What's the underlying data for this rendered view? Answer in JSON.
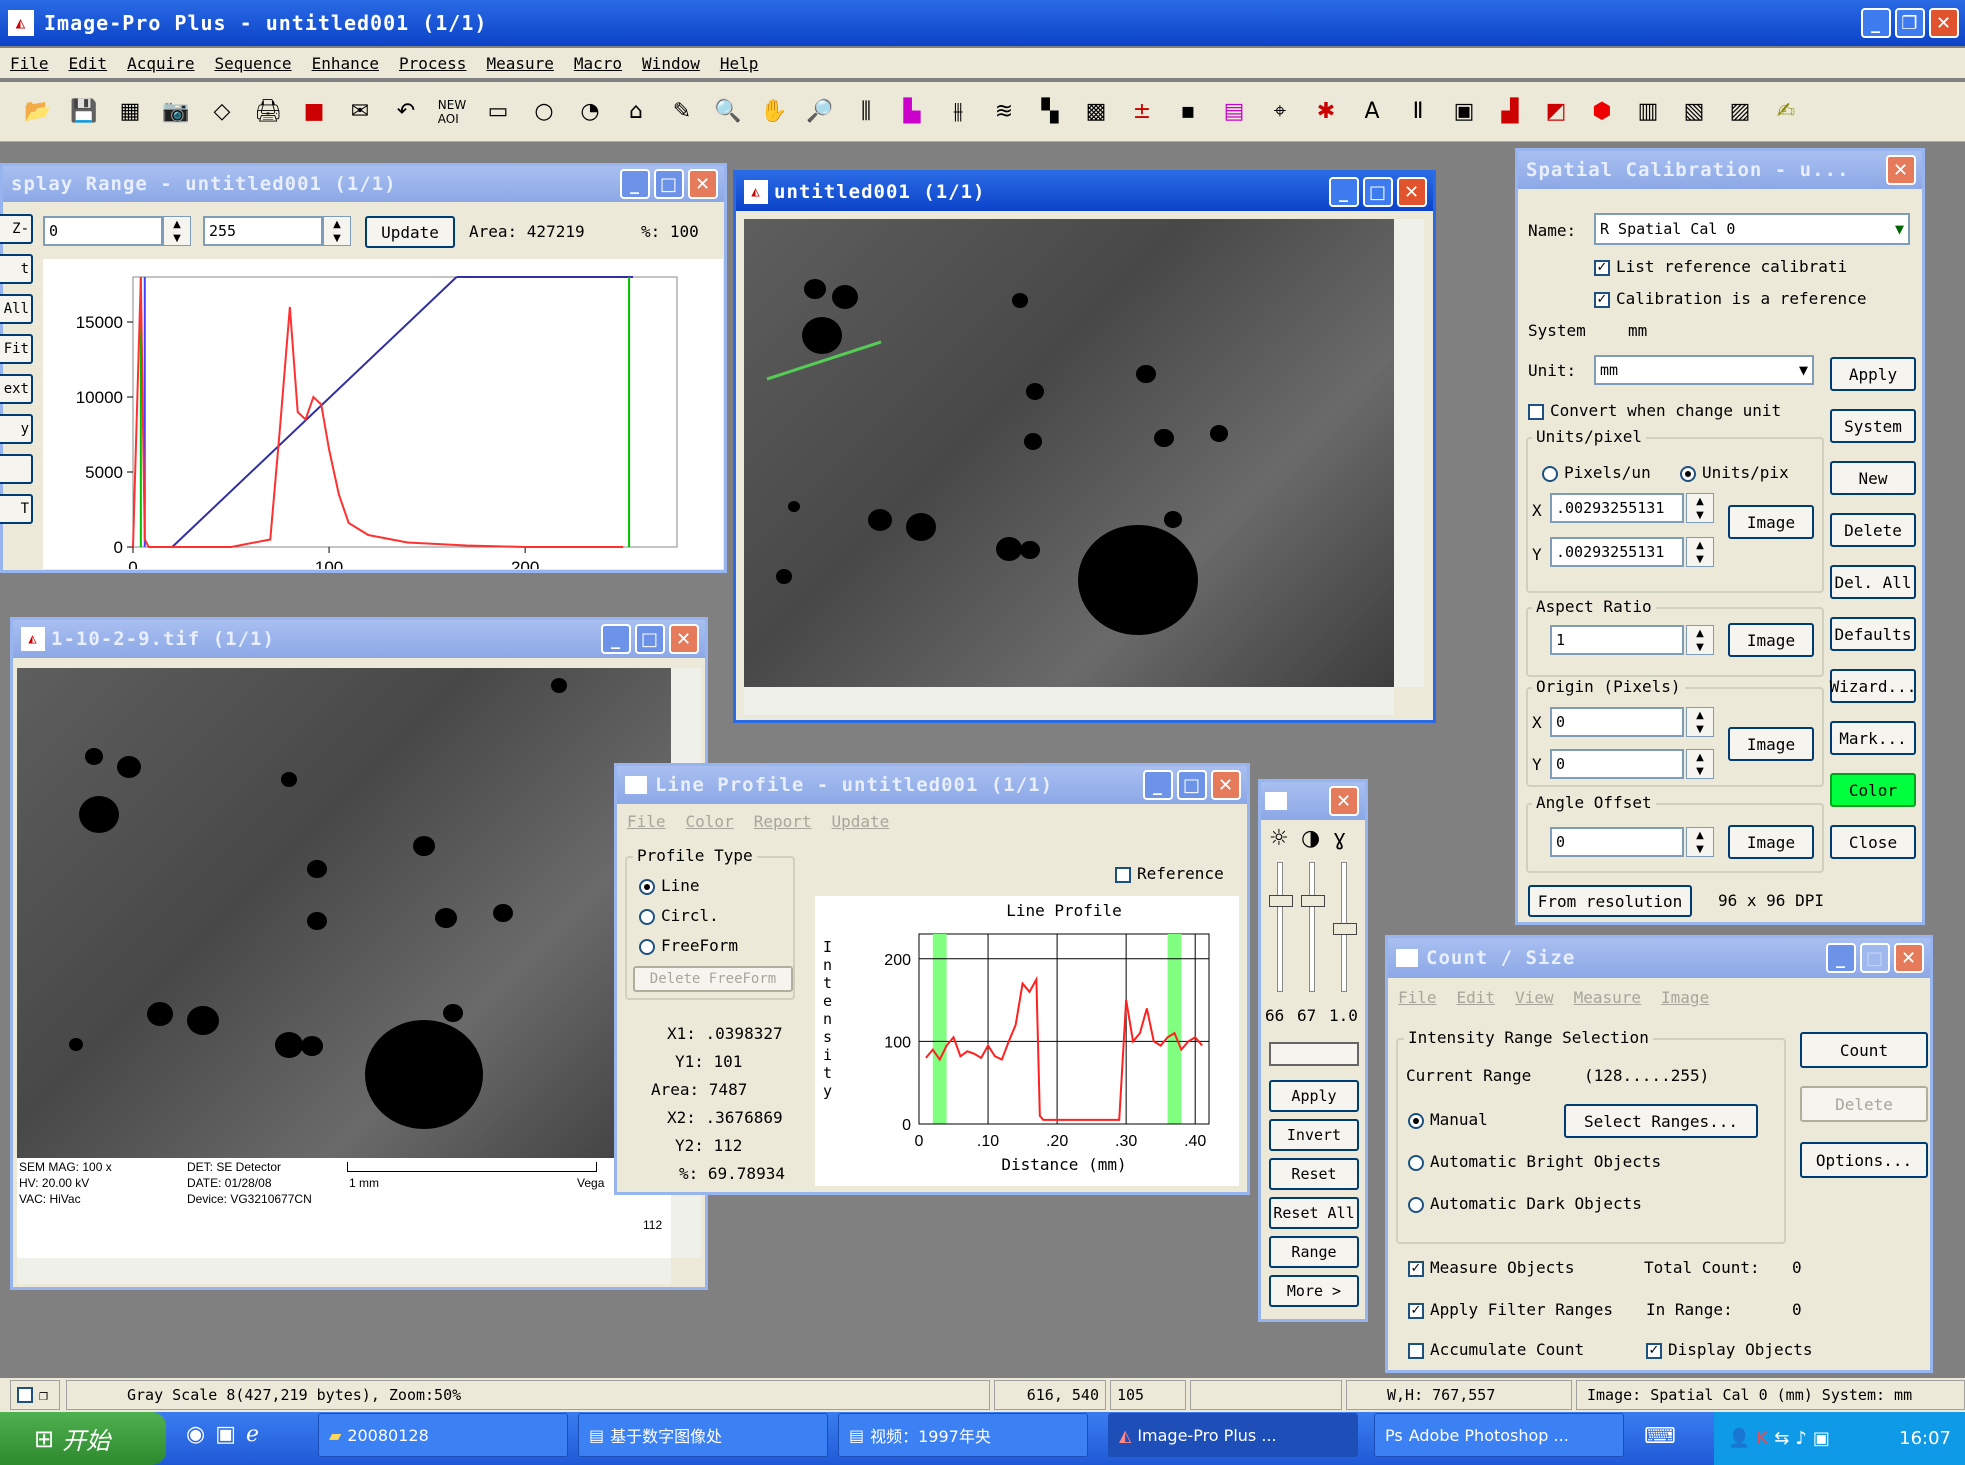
{
  "app": {
    "title": "Image-Pro Plus - untitled001 (1/1)"
  },
  "menu": [
    "File",
    "Edit",
    "Acquire",
    "Sequence",
    "Enhance",
    "Process",
    "Measure",
    "Macro",
    "Window",
    "Help"
  ],
  "display_range": {
    "title": "splay Range - untitled001 (1/1)",
    "min": "0",
    "max": "255",
    "update": "Update",
    "area_label": "Area: 427219",
    "pct_label": "%: 100",
    "side_buttons": [
      "Z-",
      "t",
      "All",
      "Fit",
      "ext",
      "y",
      "",
      "T"
    ]
  },
  "histogram": {
    "type": "line",
    "x": [
      0,
      4,
      5,
      6,
      8,
      20,
      50,
      70,
      75,
      80,
      84,
      88,
      92,
      96,
      100,
      105,
      110,
      120,
      140,
      170,
      200,
      250
    ],
    "y": [
      0,
      18000,
      9000,
      500,
      0,
      0,
      0,
      500,
      8000,
      16000,
      9000,
      8500,
      10000,
      9500,
      6500,
      3500,
      1600,
      800,
      300,
      100,
      0,
      0
    ],
    "ylim": [
      0,
      18000
    ],
    "xlim": [
      0,
      255
    ],
    "yticks": [
      0,
      5000,
      10000,
      15000
    ],
    "xticks": [
      0,
      100,
      200
    ],
    "colors": {
      "series": "#ff3030",
      "line": "#3030a0",
      "marker_green": "#00c000",
      "marker_blue": "#4040ff"
    }
  },
  "untitled_win": {
    "title": "untitled001 (1/1)"
  },
  "tif_win": {
    "title": "1-10-2-9.tif (1/1)",
    "info": [
      "SEM MAG: 100 x",
      "HV: 20.00 kV",
      "VAC: HiVac",
      "DET: SE Detector",
      "DATE: 01/28/08",
      "Device: VG3210677CN",
      "1 mm",
      "Vega",
      "112"
    ]
  },
  "spatial": {
    "title": "Spatial Calibration - u...",
    "name_label": "Name:",
    "name_value": "R  Spatial Cal 0",
    "list_ref": "List reference calibrati",
    "calib_ref": "Calibration is a reference",
    "system_label": "System",
    "system_value": "mm",
    "unit_label": "Unit:",
    "unit_value": "mm",
    "convert": "Convert when change unit",
    "units_pixel": "Units/pixel",
    "pixels_un": "Pixels/un",
    "units_pix": "Units/pix",
    "x_label": "X",
    "x_value": ".00293255131",
    "y_label": "Y",
    "y_value": ".00293255131",
    "aspect": "Aspect Ratio",
    "aspect_value": "1",
    "origin": "Origin (Pixels)",
    "ox": "0",
    "oy": "0",
    "angle": "Angle Offset",
    "angle_value": "0",
    "image": "Image",
    "from_res": "From resolution",
    "dpi": "96 x 96 DPI",
    "buttons": [
      "Apply",
      "System",
      "New",
      "Delete",
      "Del. All",
      "Defaults",
      "Wizard...",
      "Mark...",
      "Color",
      "Close"
    ]
  },
  "line_profile": {
    "title": "Line Profile - untitled001 (1/1)",
    "menu": [
      "File",
      "Color",
      "Report",
      "Update"
    ],
    "profile_type": "Profile Type",
    "line": "Line",
    "circle": "Circl.",
    "freeform": "FreeForm",
    "delete_freeform": "Delete FreeForm",
    "reference": "Reference",
    "x1": "X1: .0398327",
    "y1": "Y1: 101",
    "area": "Area: 7487",
    "x2": "X2: .3676869",
    "y2": "Y2: 112",
    "pct": "%: 69.78934"
  },
  "lp_chart": {
    "type": "line",
    "title": "Line Profile",
    "xlabel": "Distance (mm)",
    "ylabel": "Intensity",
    "xticks": [
      0,
      10,
      20,
      30,
      40
    ],
    "xtick_labels": [
      "0",
      ".10",
      ".20",
      ".30",
      ".40"
    ],
    "yticks": [
      0,
      100,
      200
    ],
    "xlim": [
      0,
      42
    ],
    "ylim": [
      0,
      230
    ],
    "x": [
      1,
      2,
      3,
      4,
      5,
      6,
      7,
      8,
      9,
      10,
      11,
      12,
      13,
      14,
      15,
      16,
      17,
      17.5,
      18,
      19,
      20,
      25,
      29,
      30,
      31,
      32,
      33,
      34,
      35,
      36,
      37,
      38,
      39,
      40,
      41
    ],
    "y": [
      80,
      90,
      78,
      95,
      105,
      82,
      88,
      85,
      80,
      95,
      82,
      78,
      100,
      120,
      170,
      160,
      175,
      10,
      5,
      5,
      5,
      5,
      5,
      150,
      100,
      110,
      140,
      100,
      95,
      105,
      110,
      90,
      100,
      105,
      95
    ],
    "colors": {
      "series": "#ff2020",
      "band": "#80ff80"
    }
  },
  "adjust": {
    "values": [
      "66",
      "67",
      "1.0"
    ],
    "buttons": [
      "Apply",
      "Invert",
      "Reset",
      "Reset All",
      "Range",
      "More >"
    ]
  },
  "count_size": {
    "title": "Count / Size",
    "menu": [
      "File",
      "Edit",
      "View",
      "Measure",
      "Image"
    ],
    "intensity": "Intensity Range Selection",
    "current_label": "Current Range",
    "current_value": "(128.....255)",
    "manual": "Manual",
    "select_ranges": "Select Ranges...",
    "auto_bright": "Automatic Bright Objects",
    "auto_dark": "Automatic Dark Objects",
    "measure": "Measure Objects",
    "total_count": "Total Count:",
    "total_value": "0",
    "filter": "Apply Filter Ranges",
    "in_range": "In Range:",
    "in_range_value": "0",
    "accumulate": "Accumulate Count",
    "display": "Display Objects",
    "count": "Count",
    "delete": "Delete",
    "options": "Options..."
  },
  "status": {
    "gray": "Gray Scale 8(427,219 bytes), Zoom:50%",
    "xy": "616, 540",
    "val": "105",
    "wh": "W,H: 767,557",
    "image": "Image: Spatial Cal 0 (mm) System: mm"
  },
  "taskbar": {
    "start": "开始",
    "items": [
      "20080128",
      "基于数字图像处",
      "视频：1997年央",
      "Image-Pro Plus ...",
      "Adobe Photoshop ..."
    ],
    "time": "16:07"
  }
}
